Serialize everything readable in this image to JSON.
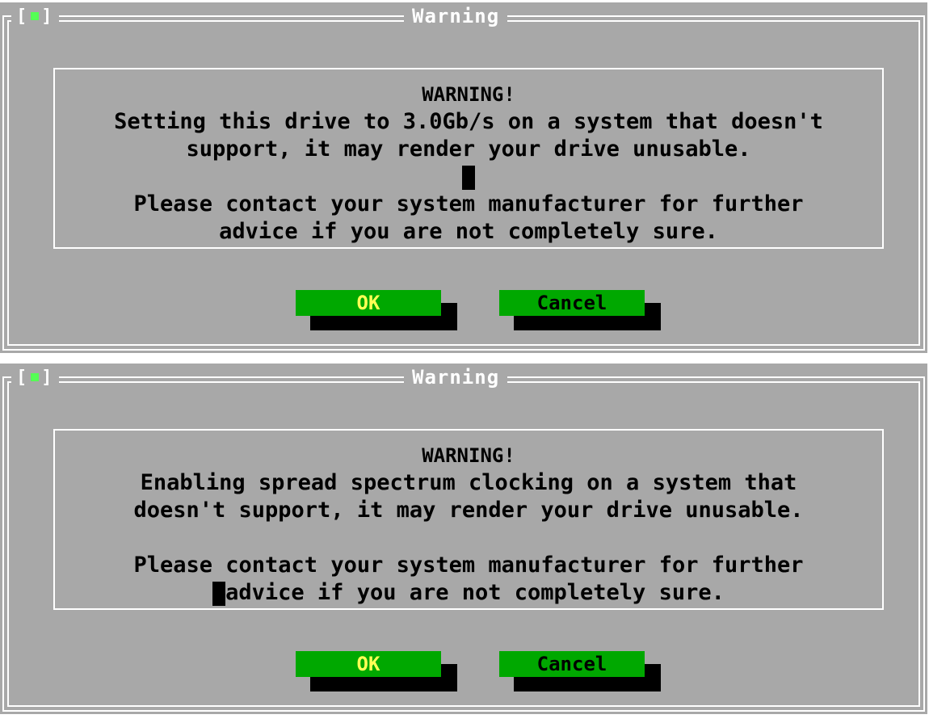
{
  "dialogs": [
    {
      "close_box": "[■]",
      "title": "Warning",
      "heading": "WARNING!",
      "lines": [
        "Setting this drive to 3.0Gb/s on a system that doesn't",
        "support, it may render your drive unusable.",
        "",
        "Please contact your system manufacturer for further",
        "advice if you are not completely sure."
      ],
      "ok_label": "OK",
      "cancel_label": "Cancel"
    },
    {
      "close_box": "[■]",
      "title": "Warning",
      "heading": "WARNING!",
      "lines": [
        "Enabling spread spectrum clocking on a system that",
        "doesn't support, it may render your drive unusable.",
        "",
        "Please contact your system manufacturer for further",
        "advice if you are not completely sure."
      ],
      "ok_label": "OK",
      "cancel_label": "Cancel"
    }
  ],
  "colors": {
    "background": "#a8a8a8",
    "frame": "#ffffff",
    "button": "#00a800",
    "ok_text": "#ffff55",
    "close_indicator": "#55ff55"
  }
}
